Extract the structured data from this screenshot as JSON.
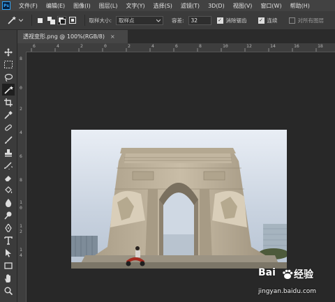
{
  "app": {
    "logo": "Ps"
  },
  "menu": [
    "文件(F)",
    "编辑(E)",
    "图像(I)",
    "图层(L)",
    "文字(Y)",
    "选择(S)",
    "滤镜(T)",
    "3D(D)",
    "视图(V)",
    "窗口(W)",
    "帮助(H)"
  ],
  "options": {
    "sample_size_label": "取样大小:",
    "sample_size_value": "取样点",
    "tolerance_label": "容差:",
    "tolerance_value": "32",
    "antialias_label": "消除锯齿",
    "contiguous_label": "连续",
    "all_layers_label": "对所有图层"
  },
  "document": {
    "tab_title": "透视变形.png @ 100%(RGB/8)",
    "close_glyph": "×"
  },
  "rulers": {
    "top": [
      "6",
      "4",
      "2",
      "0",
      "2",
      "4",
      "6",
      "8",
      "10",
      "12",
      "14",
      "16",
      "18"
    ],
    "left": [
      "8",
      "0",
      "2",
      "4",
      "6",
      "8",
      "1",
      "0",
      "1",
      "2",
      "1",
      "4"
    ]
  },
  "watermark": {
    "brand": "Bai",
    "brand_cn": "经验",
    "url": "jingyan.baidu.com"
  },
  "tool_icons": [
    "move-icon",
    "marquee-icon",
    "lasso-icon",
    "magic-wand-icon",
    "crop-icon",
    "eyedropper-icon",
    "healing-icon",
    "brush-icon",
    "stamp-icon",
    "history-brush-icon",
    "eraser-icon",
    "bucket-icon",
    "blur-icon",
    "dodge-icon",
    "pen-icon",
    "type-icon",
    "path-select-icon",
    "rectangle-icon",
    "hand-icon",
    "zoom-icon"
  ],
  "colors": {
    "accent": "#31a8ff",
    "menubar": "#424242",
    "panel": "#3b3b3b",
    "canvas": "#282828"
  }
}
